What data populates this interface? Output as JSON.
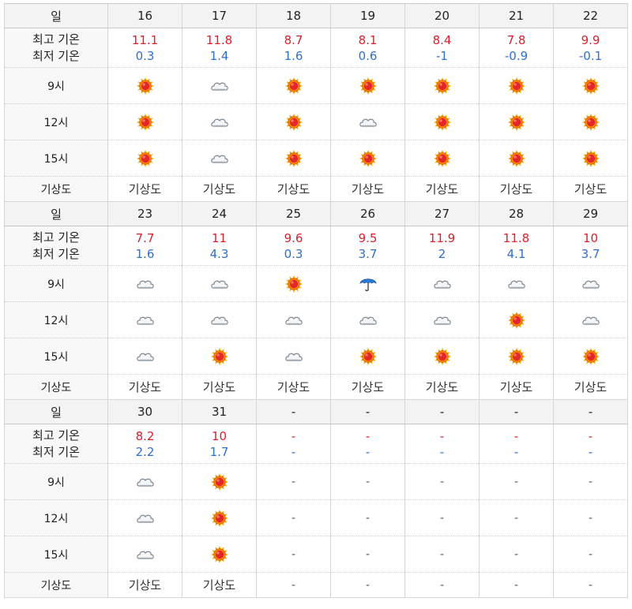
{
  "labels": {
    "day": "일",
    "high": "최고 기온",
    "low": "최저 기온",
    "h9": "9시",
    "h12": "12시",
    "h15": "15시",
    "map": "기상도"
  },
  "weeks": [
    {
      "days": [
        "16",
        "17",
        "18",
        "19",
        "20",
        "21",
        "22"
      ],
      "highs": [
        "11.1",
        "11.8",
        "8.7",
        "8.1",
        "8.4",
        "7.8",
        "9.9"
      ],
      "lows": [
        "0.3",
        "1.4",
        "1.6",
        "0.6",
        "-1",
        "-0.9",
        "-0.1"
      ],
      "h9": [
        "sun",
        "cloud",
        "sun",
        "sun",
        "sun",
        "sun",
        "sun"
      ],
      "h12": [
        "sun",
        "cloud",
        "sun",
        "cloud",
        "sun",
        "sun",
        "sun"
      ],
      "h15": [
        "sun",
        "cloud",
        "sun",
        "sun",
        "sun",
        "sun",
        "sun"
      ],
      "map": [
        "기상도",
        "기상도",
        "기상도",
        "기상도",
        "기상도",
        "기상도",
        "기상도"
      ]
    },
    {
      "days": [
        "23",
        "24",
        "25",
        "26",
        "27",
        "28",
        "29"
      ],
      "highs": [
        "7.7",
        "11",
        "9.6",
        "9.5",
        "11.9",
        "11.8",
        "10"
      ],
      "lows": [
        "1.6",
        "4.3",
        "0.3",
        "3.7",
        "2",
        "4.1",
        "3.7"
      ],
      "h9": [
        "cloud",
        "cloud",
        "sun",
        "umbrella",
        "cloud",
        "cloud",
        "cloud"
      ],
      "h12": [
        "cloud",
        "cloud",
        "cloud",
        "cloud",
        "cloud",
        "sun",
        "cloud"
      ],
      "h15": [
        "cloud",
        "sun",
        "cloud",
        "sun",
        "sun",
        "sun",
        "sun"
      ],
      "map": [
        "기상도",
        "기상도",
        "기상도",
        "기상도",
        "기상도",
        "기상도",
        "기상도"
      ]
    },
    {
      "days": [
        "30",
        "31",
        "-",
        "-",
        "-",
        "-",
        "-"
      ],
      "highs": [
        "8.2",
        "10",
        "-",
        "-",
        "-",
        "-",
        "-"
      ],
      "lows": [
        "2.2",
        "1.7",
        "-",
        "-",
        "-",
        "-",
        "-"
      ],
      "h9": [
        "cloud",
        "sun",
        "-",
        "-",
        "-",
        "-",
        "-"
      ],
      "h12": [
        "cloud",
        "sun",
        "-",
        "-",
        "-",
        "-",
        "-"
      ],
      "h15": [
        "cloud",
        "sun",
        "-",
        "-",
        "-",
        "-",
        "-"
      ],
      "map": [
        "기상도",
        "기상도",
        "-",
        "-",
        "-",
        "-",
        "-"
      ]
    }
  ],
  "colors": {
    "high": "#e01e2b",
    "low": "#2f6fd1"
  }
}
